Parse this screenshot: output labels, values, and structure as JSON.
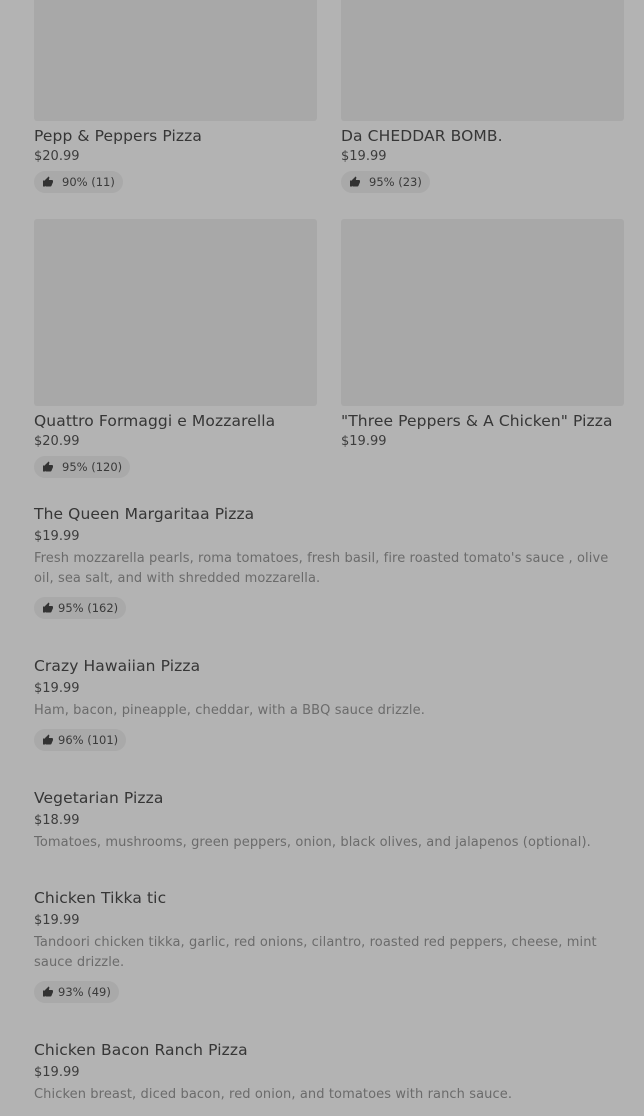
{
  "grid_items": [
    {
      "name": "Pepp & Peppers Pizza",
      "price": "$20.99",
      "rating": "90% (11)"
    },
    {
      "name": "Da CHEDDAR BOMB.",
      "price": "$19.99",
      "rating": "95% (23)"
    },
    {
      "name": "Quattro Formaggi e Mozzarella",
      "price": "$20.99",
      "rating": "95% (120)"
    },
    {
      "name": "\"Three Peppers & A Chicken\" Pizza",
      "price": "$19.99",
      "rating": ""
    }
  ],
  "list_items": [
    {
      "name": "The Queen Margaritaa Pizza",
      "price": "$19.99",
      "description": "Fresh mozzarella pearls, roma tomatoes, fresh basil, fire roasted tomato's sauce , olive oil, sea salt, and with shredded mozzarella.",
      "rating": "95% (162)"
    },
    {
      "name": "Crazy Hawaiian Pizza",
      "price": "$19.99",
      "description": "Ham, bacon, pineapple, cheddar, with a BBQ sauce drizzle.",
      "rating": "96% (101)"
    },
    {
      "name": "Vegetarian Pizza",
      "price": "$18.99",
      "description": "Tomatoes, mushrooms, green peppers, onion, black olives, and jalapenos (optional).",
      "rating": ""
    },
    {
      "name": "Chicken Tikka tic",
      "price": "$19.99",
      "description": "Tandoori chicken tikka, garlic, red onions, cilantro, roasted red peppers, cheese, mint sauce drizzle.",
      "rating": "93% (49)"
    },
    {
      "name": "Chicken Bacon Ranch Pizza",
      "price": "$19.99",
      "description": "Chicken breast, diced bacon, red onion, and tomatoes with ranch sauce.",
      "rating": ""
    }
  ],
  "icons": {
    "rating": "thumbs-up-icon"
  },
  "colors": {
    "background": "#b3b3b3",
    "image_placeholder": "#a8a8a8",
    "rating_pill": "#a9a9a9"
  }
}
